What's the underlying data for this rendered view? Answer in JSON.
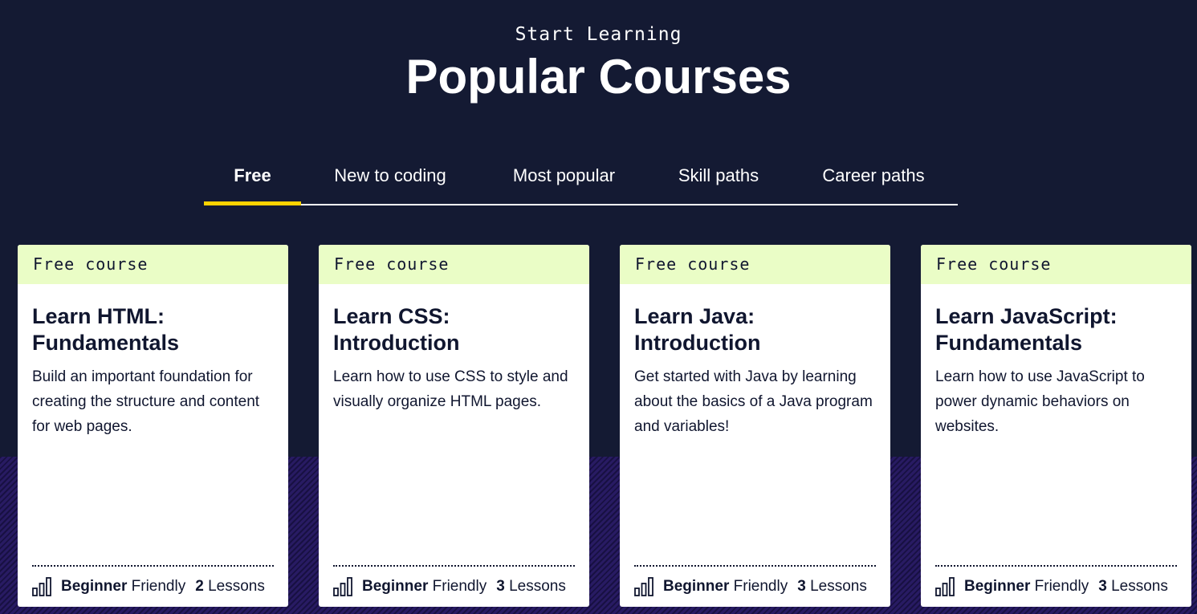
{
  "header": {
    "eyebrow": "Start Learning",
    "title": "Popular Courses"
  },
  "tabs": [
    {
      "label": "Free",
      "active": true
    },
    {
      "label": "New to coding",
      "active": false
    },
    {
      "label": "Most popular",
      "active": false
    },
    {
      "label": "Skill paths",
      "active": false
    },
    {
      "label": "Career paths",
      "active": false
    }
  ],
  "colors": {
    "background": "#141a33",
    "tab_indicator": "#ffd300",
    "badge_background": "#eafdc6",
    "stripe_band": "#281b63"
  },
  "cards": [
    {
      "badge": "Free course",
      "title": "Learn HTML: Fundamentals",
      "description": "Build an important foundation for creating the structure and content for web pages.",
      "level_strong": "Beginner",
      "level_rest": "Friendly",
      "lessons_count": "2",
      "lessons_label": "Lessons",
      "icon": "difficulty-bars-icon"
    },
    {
      "badge": "Free course",
      "title": "Learn CSS: Introduction",
      "description": "Learn how to use CSS to style and visually organize HTML pages.",
      "level_strong": "Beginner",
      "level_rest": "Friendly",
      "lessons_count": "3",
      "lessons_label": "Lessons",
      "icon": "difficulty-bars-icon"
    },
    {
      "badge": "Free course",
      "title": "Learn Java: Introduction",
      "description": "Get started with Java by learning about the basics of a Java program and variables!",
      "level_strong": "Beginner",
      "level_rest": "Friendly",
      "lessons_count": "3",
      "lessons_label": "Lessons",
      "icon": "difficulty-bars-icon"
    },
    {
      "badge": "Free course",
      "title": "Learn JavaScript: Fundamentals",
      "description": "Learn how to use JavaScript to power dynamic behaviors on websites.",
      "level_strong": "Beginner",
      "level_rest": "Friendly",
      "lessons_count": "3",
      "lessons_label": "Lessons",
      "icon": "difficulty-bars-icon"
    }
  ]
}
